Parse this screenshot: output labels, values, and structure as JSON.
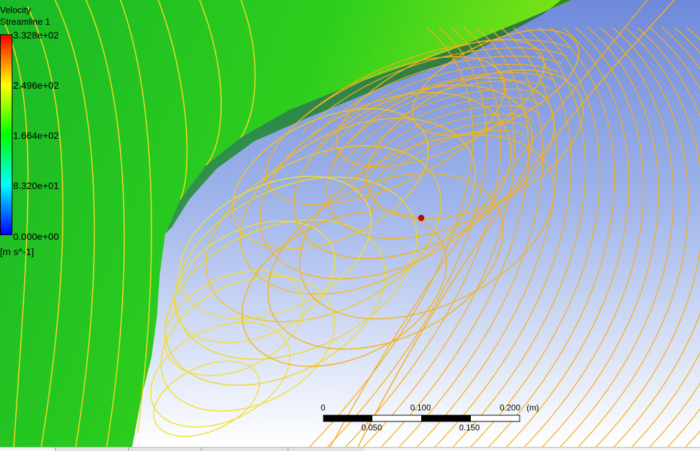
{
  "legend": {
    "title": "Velocity",
    "subtitle": "Streamline 1",
    "ticks": [
      "3.328e+02",
      "2.496e+02",
      "1.664e+02",
      "8.320e+01",
      "0.000e+00"
    ],
    "unit": "[m s^-1]",
    "gradient_colors": [
      "#ff0000",
      "#ffff00",
      "#00ff00",
      "#00ffff",
      "#0000ff"
    ]
  },
  "scale_ruler": {
    "top_labels": [
      "0",
      "0.100",
      "0.200"
    ],
    "bottom_labels": [
      "0.050",
      "0.150"
    ],
    "unit": "(m)"
  },
  "colors": {
    "background_top": "#7f98e0",
    "background_bottom": "#ffffff",
    "body_surface": "#1cc020",
    "body_surface_light": "#5fdc1a",
    "streamline_yellow": "#f0e030",
    "streamline_orange": "#f4b016",
    "probe_point": "#d40000"
  }
}
